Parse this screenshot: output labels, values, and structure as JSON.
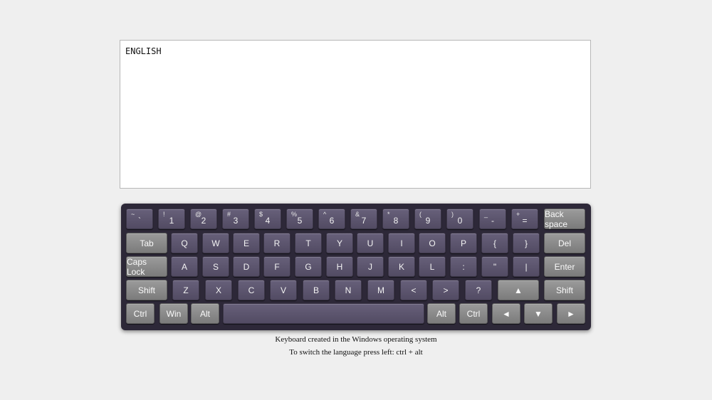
{
  "textarea": {
    "value": "ENGLISH"
  },
  "keyboard": {
    "rows": [
      [
        {
          "sup": "~",
          "label": "`",
          "name": "key-backtick"
        },
        {
          "sup": "!",
          "label": "1",
          "name": "key-1"
        },
        {
          "sup": "@",
          "label": "2",
          "name": "key-2"
        },
        {
          "sup": "#",
          "label": "3",
          "name": "key-3"
        },
        {
          "sup": "$",
          "label": "4",
          "name": "key-4"
        },
        {
          "sup": "%",
          "label": "5",
          "name": "key-5"
        },
        {
          "sup": "^",
          "label": "6",
          "name": "key-6"
        },
        {
          "sup": "&",
          "label": "7",
          "name": "key-7"
        },
        {
          "sup": "*",
          "label": "8",
          "name": "key-8"
        },
        {
          "sup": "(",
          "label": "9",
          "name": "key-9"
        },
        {
          "sup": ")",
          "label": "0",
          "name": "key-0"
        },
        {
          "sup": "_",
          "label": "-",
          "name": "key-minus"
        },
        {
          "sup": "+",
          "label": "=",
          "name": "key-equals"
        },
        {
          "label": "Back space",
          "func": true,
          "name": "key-backspace"
        }
      ],
      [
        {
          "label": "Tab",
          "func": true,
          "name": "key-tab"
        },
        {
          "label": "Q",
          "name": "key-q"
        },
        {
          "label": "W",
          "name": "key-w"
        },
        {
          "label": "E",
          "name": "key-e"
        },
        {
          "label": "R",
          "name": "key-r"
        },
        {
          "label": "T",
          "name": "key-t"
        },
        {
          "label": "Y",
          "name": "key-y"
        },
        {
          "label": "U",
          "name": "key-u"
        },
        {
          "label": "I",
          "name": "key-i"
        },
        {
          "label": "O",
          "name": "key-o"
        },
        {
          "label": "P",
          "name": "key-p"
        },
        {
          "label": "{",
          "name": "key-left-brace"
        },
        {
          "label": "}",
          "name": "key-right-brace"
        },
        {
          "label": "Del",
          "func": true,
          "name": "key-del"
        }
      ],
      [
        {
          "label": "Caps Lock",
          "func": true,
          "name": "key-caps-lock"
        },
        {
          "label": "A",
          "name": "key-a"
        },
        {
          "label": "S",
          "name": "key-s"
        },
        {
          "label": "D",
          "name": "key-d"
        },
        {
          "label": "F",
          "name": "key-f"
        },
        {
          "label": "G",
          "name": "key-g"
        },
        {
          "label": "H",
          "name": "key-h"
        },
        {
          "label": "J",
          "name": "key-j"
        },
        {
          "label": "K",
          "name": "key-k"
        },
        {
          "label": "L",
          "name": "key-l"
        },
        {
          "label": ":",
          "name": "key-colon"
        },
        {
          "label": "\"",
          "name": "key-quote"
        },
        {
          "label": "|",
          "name": "key-pipe"
        },
        {
          "label": "Enter",
          "func": true,
          "name": "key-enter"
        }
      ],
      [
        {
          "label": "Shift",
          "func": true,
          "name": "key-shift-left"
        },
        {
          "label": "Z",
          "name": "key-z"
        },
        {
          "label": "X",
          "name": "key-x"
        },
        {
          "label": "C",
          "name": "key-c"
        },
        {
          "label": "V",
          "name": "key-v"
        },
        {
          "label": "B",
          "name": "key-b"
        },
        {
          "label": "N",
          "name": "key-n"
        },
        {
          "label": "M",
          "name": "key-m"
        },
        {
          "label": "<",
          "name": "key-less-than"
        },
        {
          "label": ">",
          "name": "key-greater-than"
        },
        {
          "label": "?",
          "name": "key-question"
        },
        {
          "label": "▲",
          "func": true,
          "name": "key-arrow-up"
        },
        {
          "label": "Shift",
          "func": true,
          "name": "key-shift-right"
        }
      ],
      [
        {
          "label": "Ctrl",
          "func": true,
          "name": "key-ctrl-left"
        },
        {
          "label": "Win",
          "func": true,
          "name": "key-win"
        },
        {
          "label": "Alt",
          "func": true,
          "name": "key-alt-left"
        },
        {
          "label": "",
          "name": "key-space"
        },
        {
          "label": "Alt",
          "func": true,
          "name": "key-alt-right"
        },
        {
          "label": "Ctrl",
          "func": true,
          "name": "key-ctrl-right"
        },
        {
          "label": "◄",
          "func": true,
          "name": "key-arrow-left"
        },
        {
          "label": "▼",
          "func": true,
          "name": "key-arrow-down"
        },
        {
          "label": "►",
          "func": true,
          "name": "key-arrow-right"
        }
      ]
    ]
  },
  "captions": {
    "line1": "Keyboard created in the Windows operating system",
    "line2": "To switch the language press left: ctrl + alt"
  },
  "colors": {
    "keyboard_bg": "#2d2838",
    "key_bg": "#5d5670",
    "func_key_bg": "#8a8a8a"
  }
}
